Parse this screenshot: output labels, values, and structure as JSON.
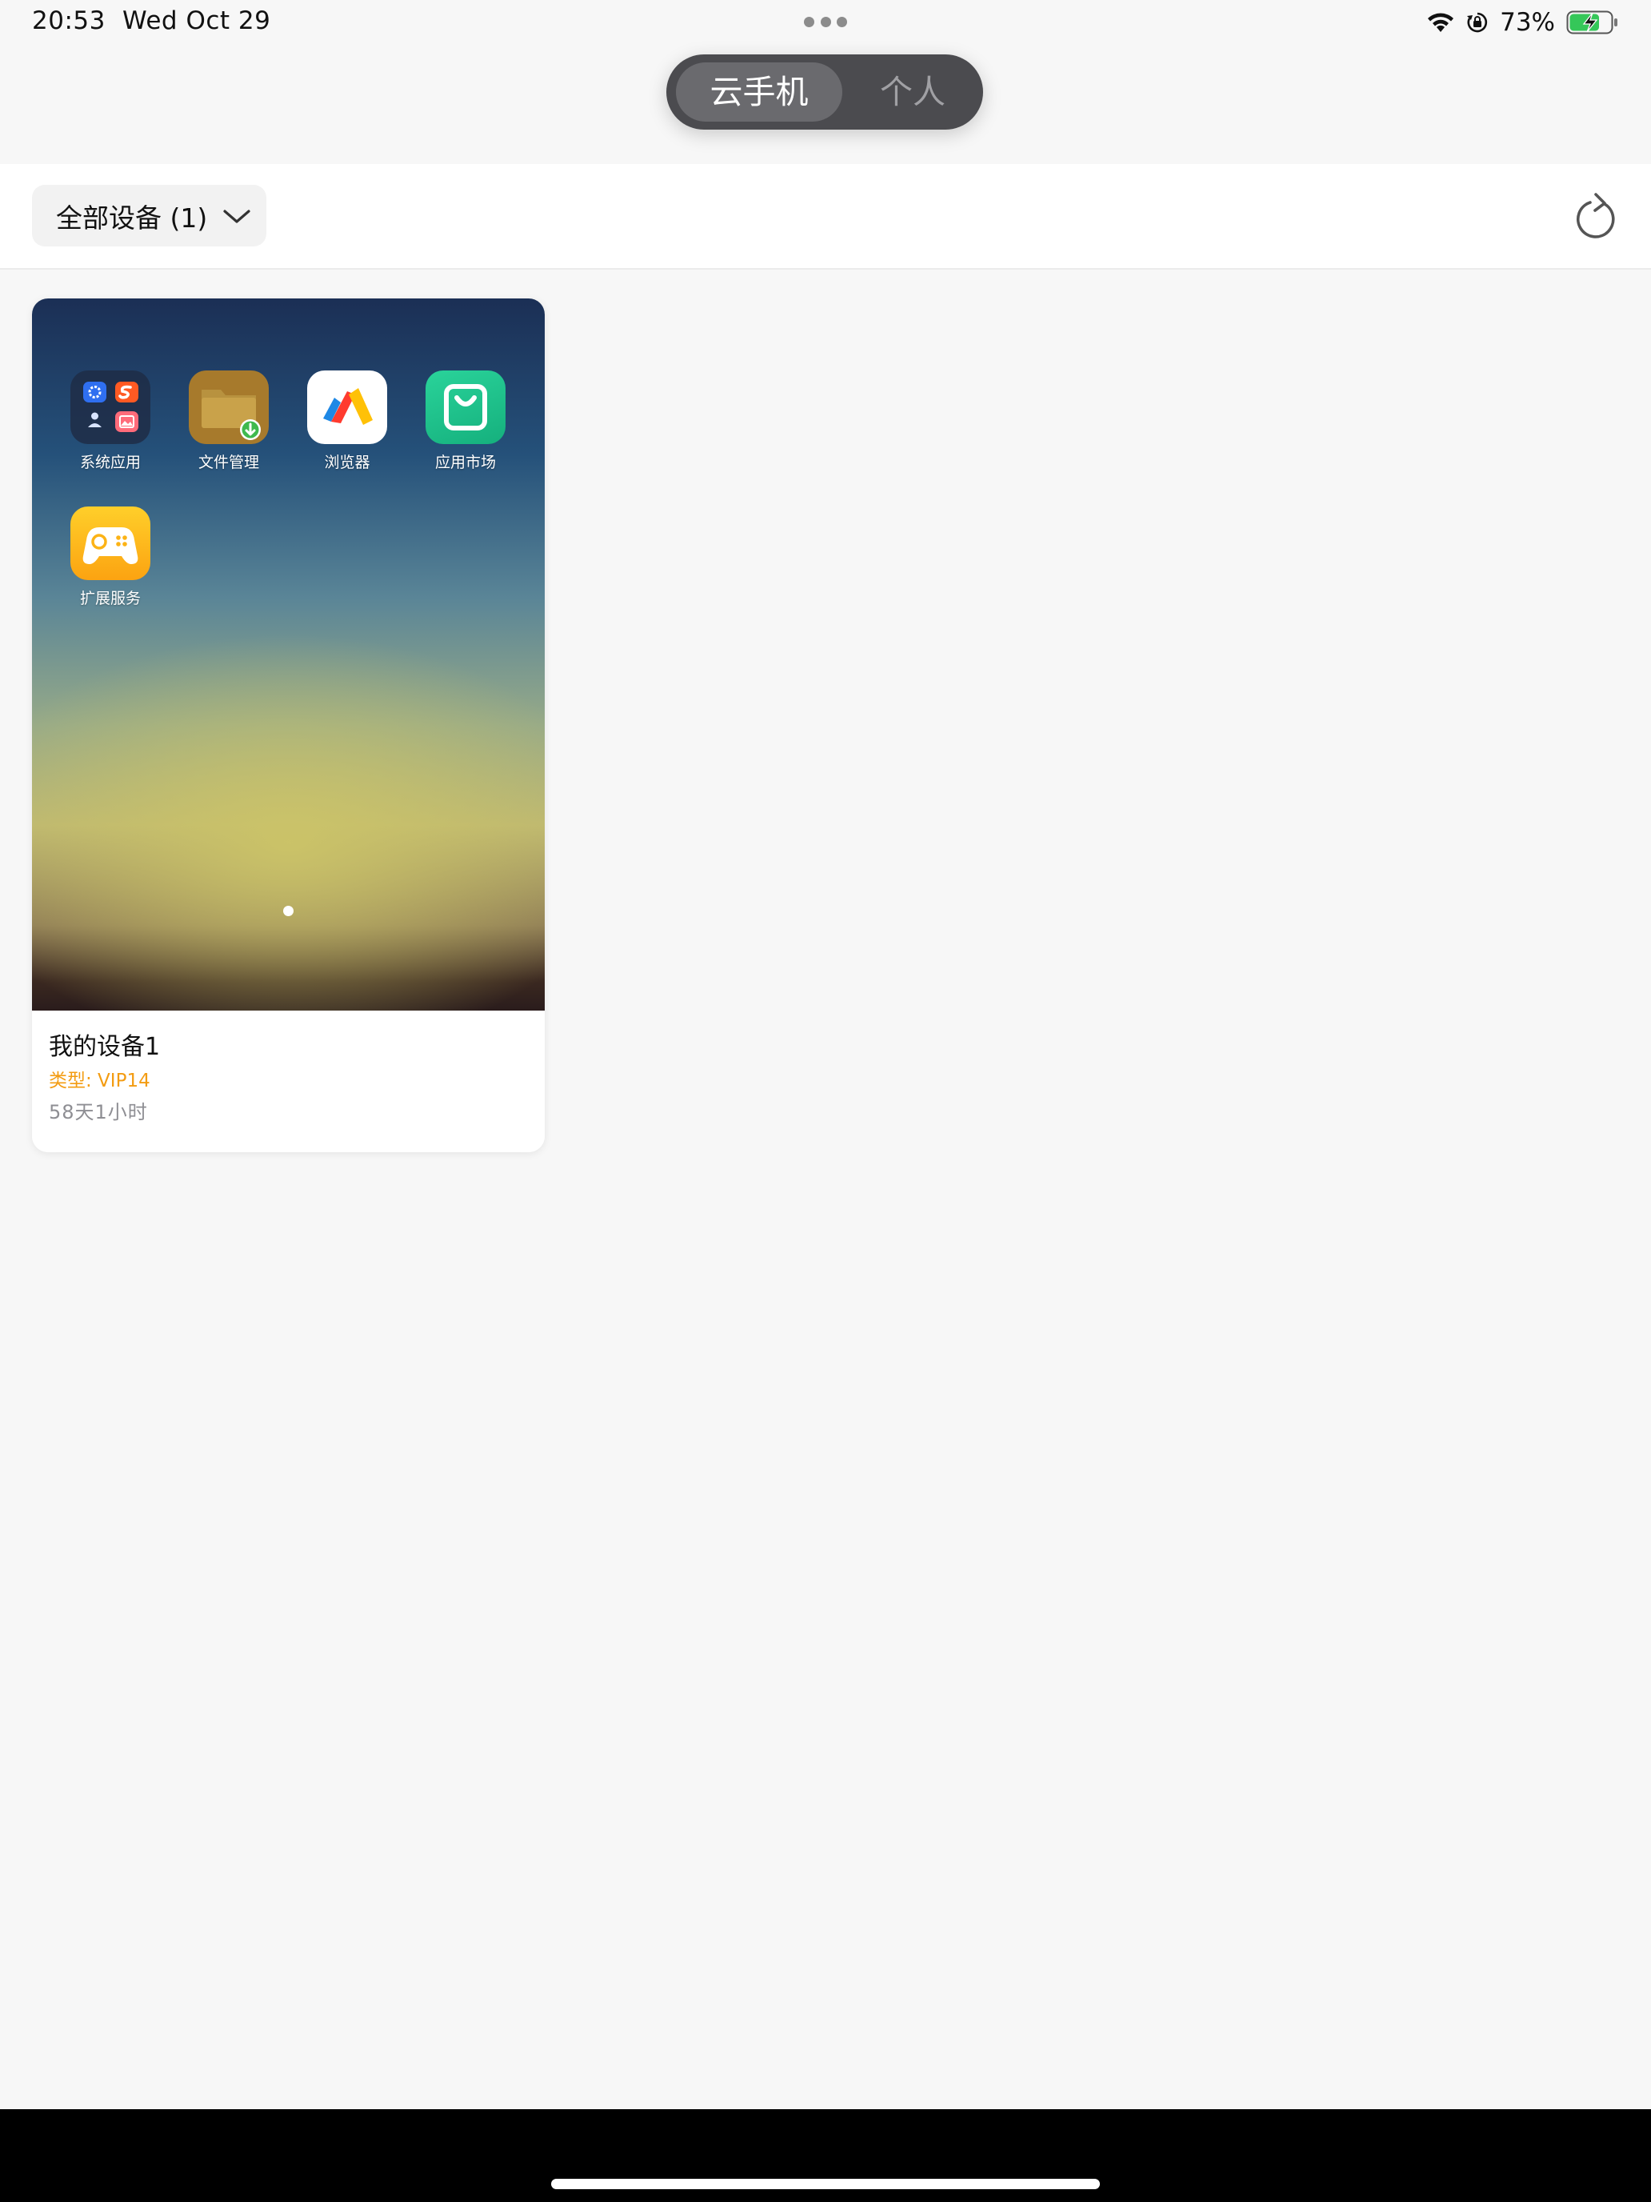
{
  "status_bar": {
    "time": "20:53",
    "date": "Wed Oct 29",
    "battery_percent": "73%",
    "battery_level": 0.73,
    "icons": [
      "wifi-icon",
      "rotation-lock-icon",
      "battery-charging-icon"
    ]
  },
  "segmented_control": {
    "options": [
      "云手机",
      "个人"
    ],
    "selected": "云手机"
  },
  "filter": {
    "label": "全部设备 (1)",
    "icons": [
      "chevron-down-icon",
      "refresh-icon"
    ]
  },
  "devices": [
    {
      "name": "我的设备1",
      "type": "类型: VIP14",
      "remaining": "58天1小时",
      "apps": [
        {
          "label": "系统应用",
          "icon": "folder-system-apps-icon"
        },
        {
          "label": "文件管理",
          "icon": "file-manager-icon"
        },
        {
          "label": "浏览器",
          "icon": "browser-icon"
        },
        {
          "label": "应用市场",
          "icon": "app-market-icon"
        },
        {
          "label": "扩展服务",
          "icon": "gamepad-icon"
        }
      ]
    }
  ],
  "colors": {
    "accent_orange": "#f39c12",
    "segment_bg": "#4b4b4f",
    "segment_active": "#6a6a6e",
    "app_market_green": "#1fc48b",
    "game_yellow": "#fdb515"
  }
}
